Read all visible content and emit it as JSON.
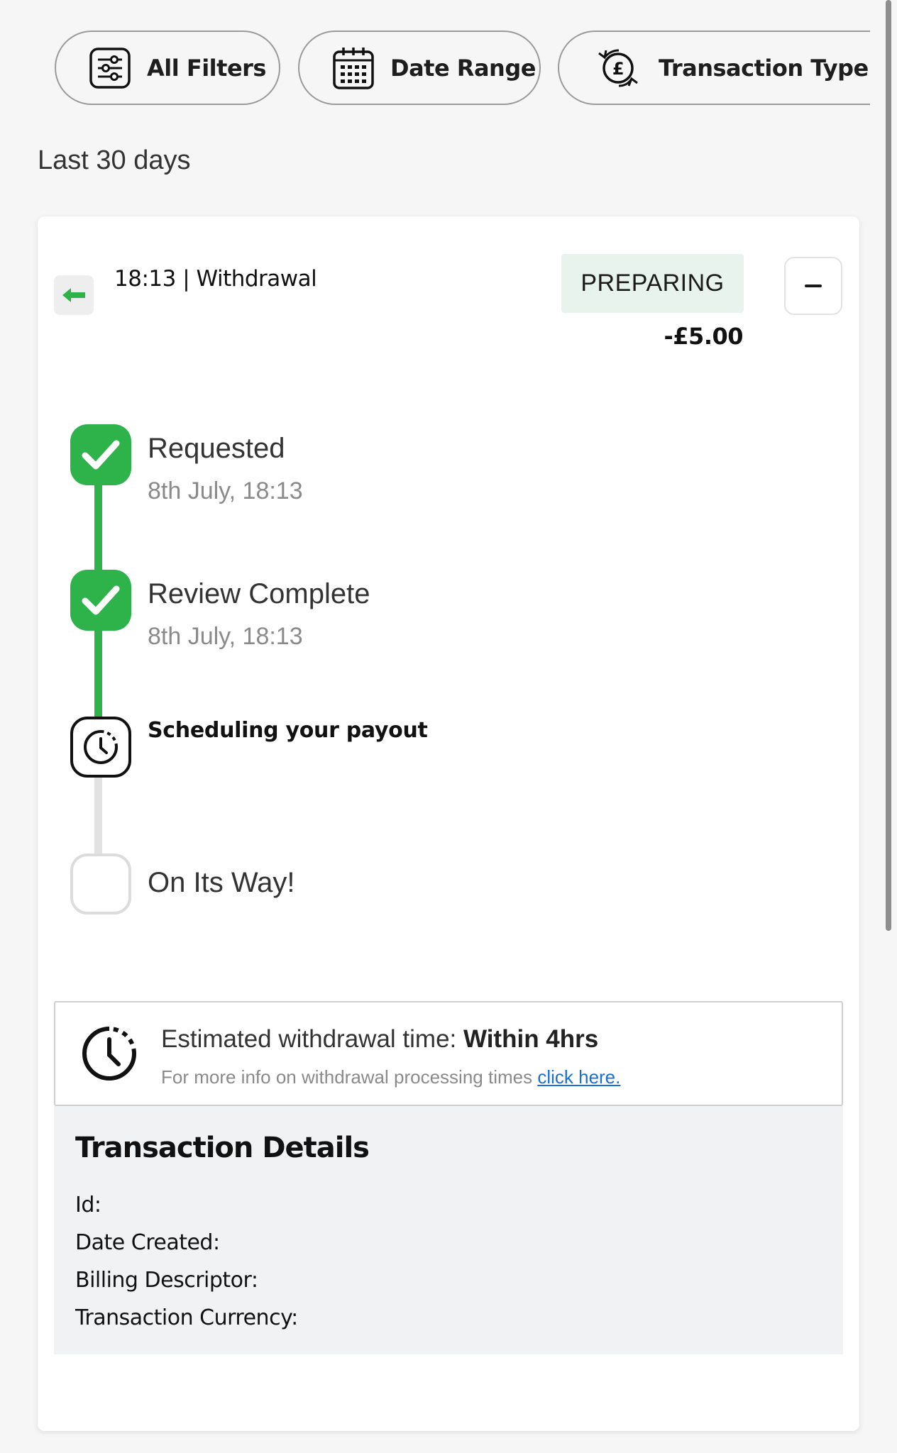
{
  "filters": {
    "all_filters": "All Filters",
    "date_range": "Date Range",
    "transaction_type": "Transaction Type"
  },
  "range_label": "Last 30 days",
  "transaction": {
    "title": "18:13 | Withdrawal",
    "status": "PREPARING",
    "amount": "-£5.00",
    "icons": {
      "direction": "arrow-left-icon",
      "collapse": "minus-icon"
    }
  },
  "timeline": {
    "steps": [
      {
        "title": "Requested",
        "subtitle": "8th July, 18:13",
        "state": "done"
      },
      {
        "title": "Review Complete",
        "subtitle": "8th July, 18:13",
        "state": "done"
      },
      {
        "title": "Scheduling your payout",
        "subtitle": "",
        "state": "active"
      },
      {
        "title": "On Its Way!",
        "subtitle": "",
        "state": "pending"
      }
    ]
  },
  "estimate": {
    "label": "Estimated withdrawal time: ",
    "value": "Within 4hrs",
    "info_text": "For more info on withdrawal processing times ",
    "link_text": "click here."
  },
  "details": {
    "title": "Transaction Details",
    "rows": [
      "Id:",
      "Date Created:",
      "Billing Descriptor:",
      "Transaction Currency:"
    ]
  },
  "colors": {
    "accent_green": "#2db34a",
    "status_badge_bg": "#e8f3ee",
    "link_blue": "#1a6fd6"
  }
}
